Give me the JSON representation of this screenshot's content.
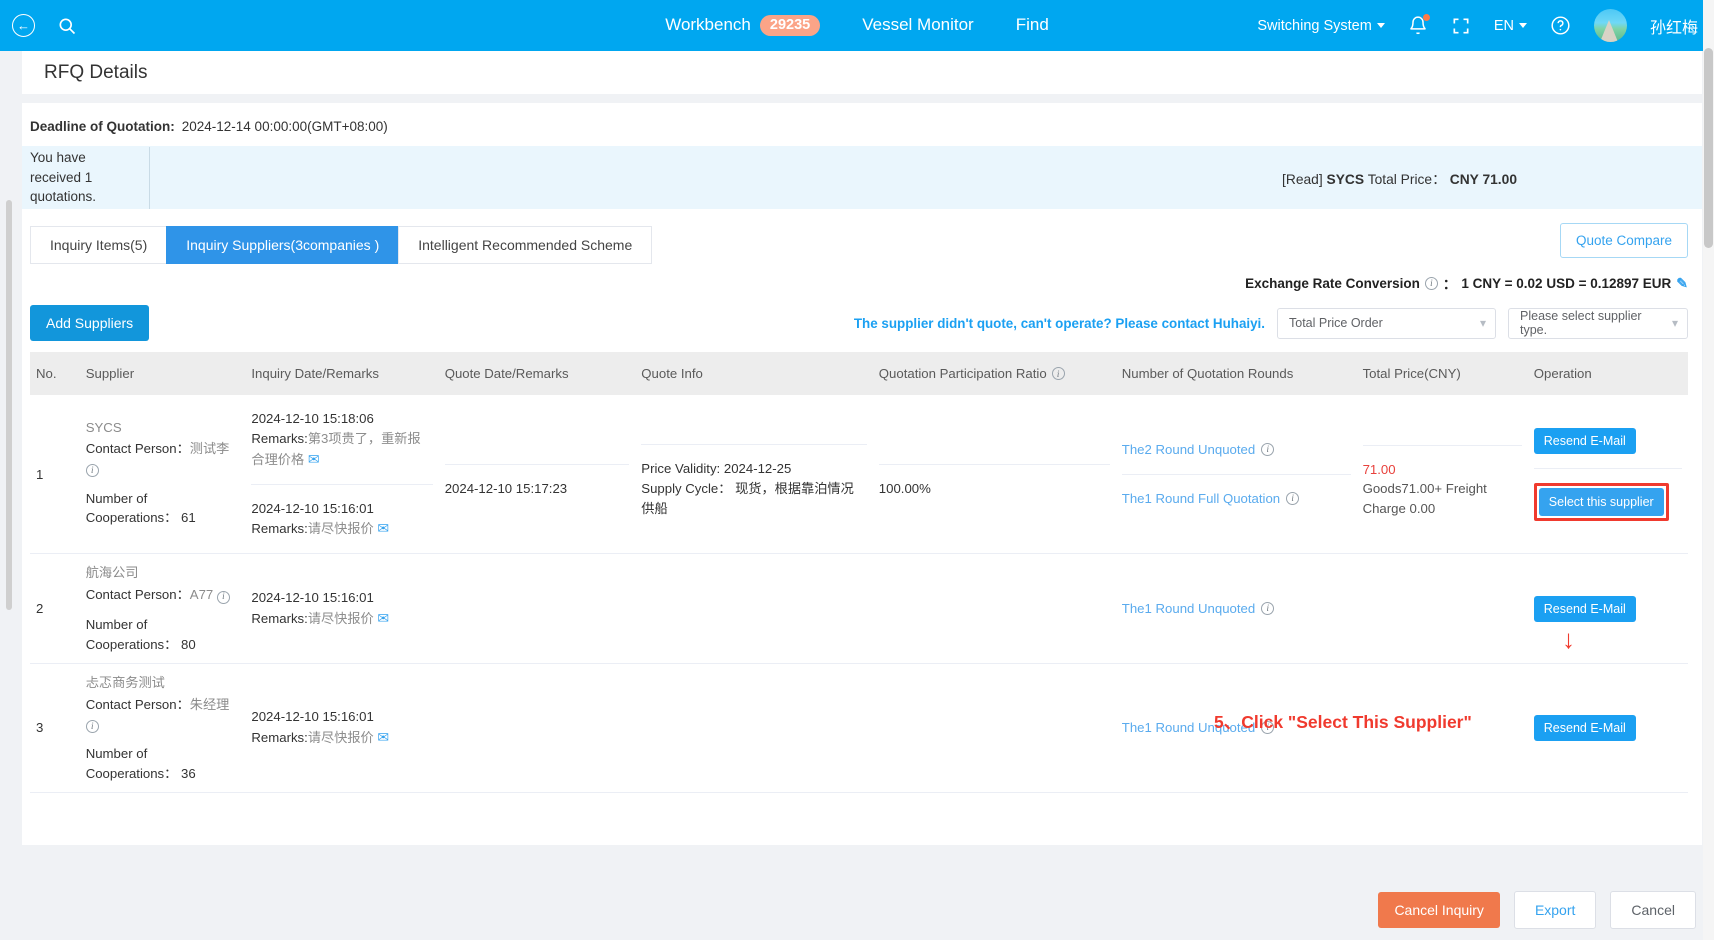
{
  "topbar": {
    "back_icon": "back-arrow-icon",
    "search_icon": "search-icon",
    "workbench_label": "Workbench",
    "workbench_count": "29235",
    "vessel_monitor_label": "Vessel Monitor",
    "find_label": "Find",
    "switching_system_label": "Switching System",
    "bell_icon": "notification-bell-icon",
    "fullscreen_icon": "fullscreen-icon",
    "language_label": "EN",
    "help_icon": "help-circle-icon",
    "user_name": "孙红梅",
    "accent": "#00a7f0",
    "badge_color": "#fba487"
  },
  "page": {
    "title": "RFQ Details"
  },
  "deadline": {
    "label": "Deadline of Quotation:",
    "value": "2024-12-14 00:00:00(GMT+08:00)"
  },
  "notice": {
    "left_text": "You have received 1 quotations.",
    "read_tag": "[Read]",
    "supplier": "SYCS",
    "total_price_label": "Total Price：",
    "total_price_value": "CNY 71.00"
  },
  "tabs": [
    {
      "label": "Inquiry Items(5)",
      "active": false
    },
    {
      "label": "Inquiry Suppliers(3companies )",
      "active": true
    },
    {
      "label": "Intelligent Recommended Scheme",
      "active": false
    }
  ],
  "quote_compare_label": "Quote Compare",
  "exchange": {
    "label": "Exchange Rate Conversion",
    "separator": "：",
    "value": "1 CNY = 0.02 USD = 0.12897 EUR",
    "edit_icon": "edit-pencil-icon"
  },
  "toolbar": {
    "add_suppliers_label": "Add Suppliers",
    "contact_message": "The supplier didn't quote, can't operate? Please contact Huhaiyi.",
    "order_select_value": "Total Price Order",
    "type_select_placeholder": "Please select supplier type."
  },
  "table": {
    "headers": [
      "No.",
      "Supplier",
      "Inquiry Date/Remarks",
      "Quote Date/Remarks",
      "Quote Info",
      "Quotation Participation Ratio",
      "Number of Quotation Rounds",
      "Total Price(CNY)",
      "Operation"
    ],
    "contact_person_label": "Contact Person：",
    "cooperations_label": "Number of Cooperations：",
    "remarks_prefix": "Remarks:",
    "rows": [
      {
        "no": "1",
        "supplier": "SYCS",
        "contact_person": "测试李",
        "cooperations": "61",
        "sub": [
          {
            "inquiry_date": "2024-12-10 15:18:06",
            "inquiry_remarks": "第3项贵了，重新报合理价格",
            "quote_date": "",
            "quote_info": [],
            "ratio": "",
            "round": "The2 Round Unquoted",
            "total_price": "",
            "total_price_detail": "",
            "operation": "Resend E-Mail",
            "operation_type": "resend"
          },
          {
            "inquiry_date": "2024-12-10 15:16:01",
            "inquiry_remarks": "请尽快报价",
            "quote_date": "2024-12-10 15:17:23",
            "quote_info": [
              "Price Validity: 2024-12-25",
              "Supply Cycle： 现货，根据靠泊情况供船"
            ],
            "ratio": "100.00%",
            "round": "The1 Round Full Quotation",
            "total_price": "71.00",
            "total_price_detail": "Goods71.00+ Freight Charge 0.00",
            "operation": "Select this supplier",
            "operation_type": "select"
          }
        ]
      },
      {
        "no": "2",
        "supplier": "航海公司",
        "contact_person": "A77",
        "cooperations": "80",
        "sub": [
          {
            "inquiry_date": "2024-12-10 15:16:01",
            "inquiry_remarks": "请尽快报价",
            "quote_date": "",
            "quote_info": [],
            "ratio": "",
            "round": "The1 Round Unquoted",
            "total_price": "",
            "total_price_detail": "",
            "operation": "Resend E-Mail",
            "operation_type": "resend"
          }
        ]
      },
      {
        "no": "3",
        "supplier": "忐忑商务测试",
        "contact_person": "朱经理",
        "cooperations": "36",
        "sub": [
          {
            "inquiry_date": "2024-12-10 15:16:01",
            "inquiry_remarks": "请尽快报价",
            "quote_date": "",
            "quote_info": [],
            "ratio": "",
            "round": "The1 Round Unquoted",
            "total_price": "",
            "total_price_detail": "",
            "operation": "Resend E-Mail",
            "operation_type": "resend"
          }
        ]
      }
    ]
  },
  "annotation": {
    "arrow": "↓",
    "text": "5、Click \"Select This Supplier\"",
    "color": "#f03a2e"
  },
  "footer": {
    "cancel_inquiry_label": "Cancel Inquiry",
    "export_label": "Export",
    "cancel_label": "Cancel"
  }
}
